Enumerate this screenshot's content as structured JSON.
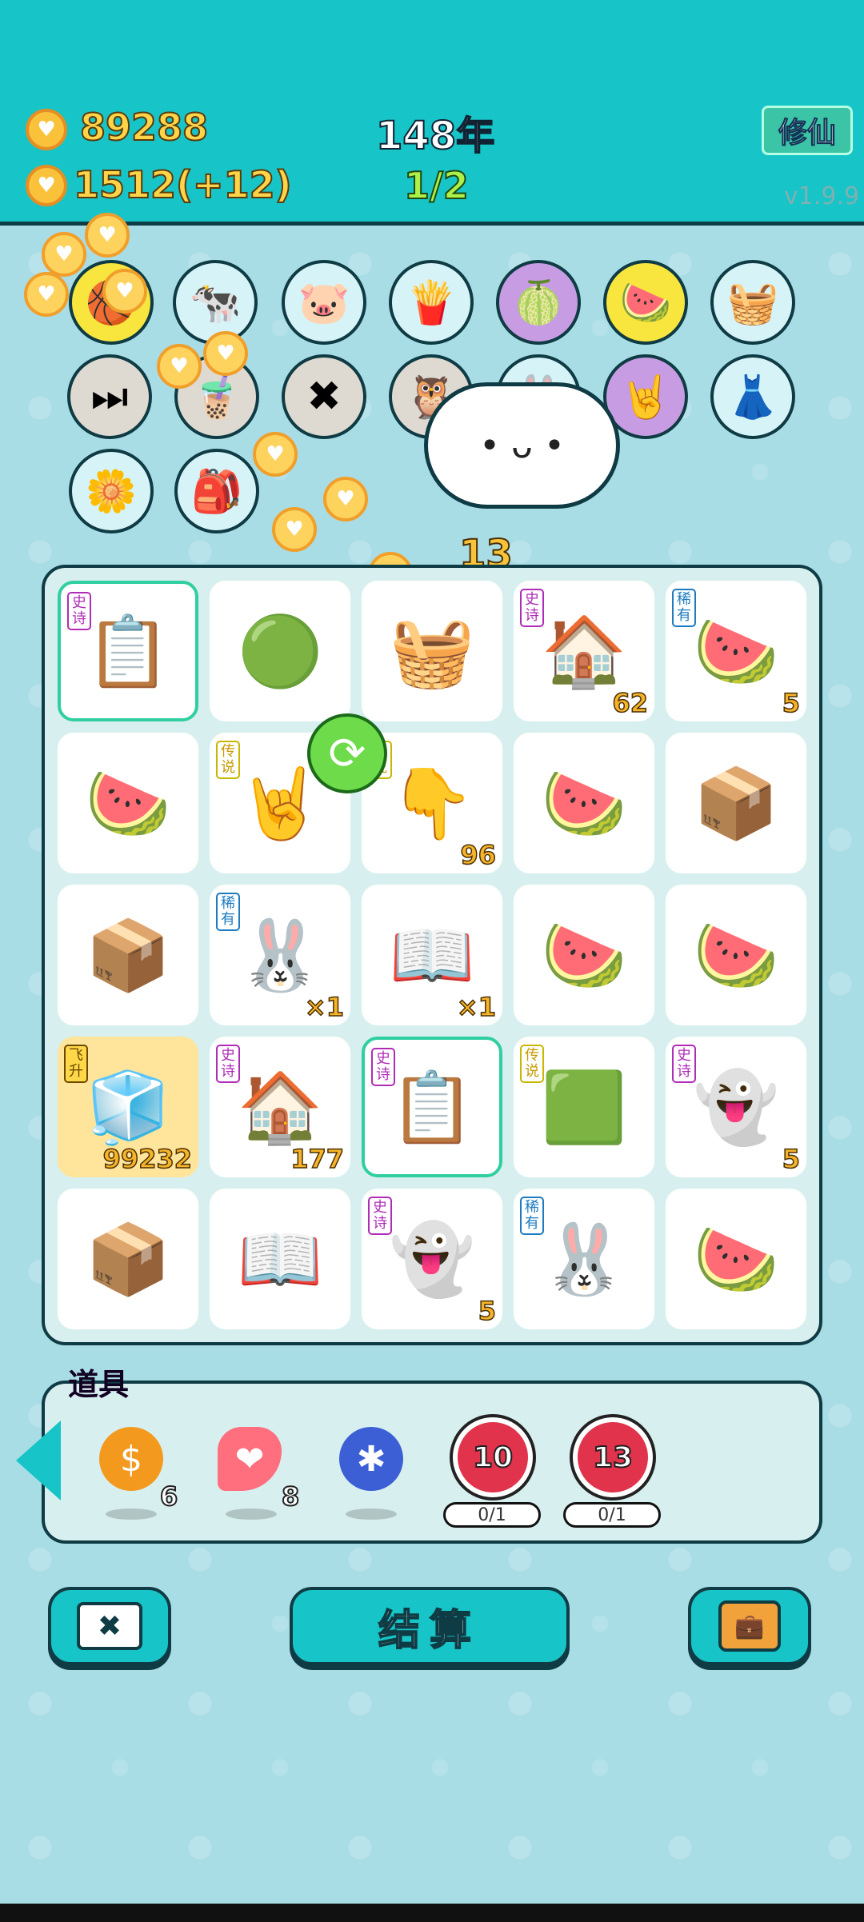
{
  "header": {
    "gold": "89288",
    "gems": "1512",
    "gems_delta": "(+12)",
    "year": "148年",
    "stage": "1/2",
    "mode_button": "修仙",
    "version": "v1.9.9"
  },
  "float_number": "13",
  "board": {
    "cells": [
      {
        "tag": "史诗",
        "tag_type": "epic",
        "icon": "copy-paste-icon",
        "count": "",
        "sel": true
      },
      {
        "tag": "",
        "tag_type": "",
        "icon": "green-potion-icon",
        "count": ""
      },
      {
        "tag": "",
        "tag_type": "",
        "icon": "basket-icon",
        "count": ""
      },
      {
        "tag": "史诗",
        "tag_type": "epic",
        "icon": "rabbit-house-icon",
        "count": "62"
      },
      {
        "tag": "稀有",
        "tag_type": "rare",
        "icon": "watermelon-slice-icon",
        "count": "5"
      },
      {
        "tag": "",
        "tag_type": "",
        "icon": "watermelon-slice-icon",
        "count": ""
      },
      {
        "tag": "传说",
        "tag_type": "legend",
        "icon": "rock-hand-icon",
        "count": ""
      },
      {
        "tag": "传说",
        "tag_type": "legend",
        "icon": "pointing-hand-icon",
        "count": "96"
      },
      {
        "tag": "",
        "tag_type": "",
        "icon": "watermelon-slice-icon",
        "count": ""
      },
      {
        "tag": "",
        "tag_type": "",
        "icon": "package-box-icon",
        "count": ""
      },
      {
        "tag": "",
        "tag_type": "",
        "icon": "package-box-icon",
        "count": ""
      },
      {
        "tag": "稀有",
        "tag_type": "rare",
        "icon": "rabbit-icon",
        "count": "×1"
      },
      {
        "tag": "",
        "tag_type": "",
        "icon": "book-icon",
        "count": "×1"
      },
      {
        "tag": "",
        "tag_type": "",
        "icon": "watermelon-slice-icon",
        "count": ""
      },
      {
        "tag": "",
        "tag_type": "",
        "icon": "watermelon-slice-icon",
        "count": ""
      },
      {
        "tag": "飞升",
        "tag_type": "ascend",
        "icon": "fridge-icon",
        "count": "99232",
        "gold": true
      },
      {
        "tag": "史诗",
        "tag_type": "epic",
        "icon": "rabbit-house-icon",
        "count": "177"
      },
      {
        "tag": "史诗",
        "tag_type": "epic",
        "icon": "copy-paste-icon",
        "count": "",
        "sel": true
      },
      {
        "tag": "传说",
        "tag_type": "legend",
        "icon": "whole-watermelon-icon",
        "count": ""
      },
      {
        "tag": "史诗",
        "tag_type": "epic",
        "icon": "ghost-icon",
        "count": "5"
      },
      {
        "tag": "",
        "tag_type": "",
        "icon": "package-box-icon",
        "count": ""
      },
      {
        "tag": "",
        "tag_type": "",
        "icon": "book-icon",
        "count": ""
      },
      {
        "tag": "史诗",
        "tag_type": "epic",
        "icon": "ghost-icon",
        "count": "5"
      },
      {
        "tag": "稀有",
        "tag_type": "rare",
        "icon": "rabbit-icon",
        "count": ""
      },
      {
        "tag": "",
        "tag_type": "",
        "icon": "watermelon-slice-icon",
        "count": ""
      }
    ]
  },
  "tools": {
    "title": "道具",
    "items": [
      {
        "icon": "dollar-coin-icon",
        "count": "6"
      },
      {
        "icon": "liver-icon",
        "count": "8"
      },
      {
        "icon": "blueberry-icon",
        "count": ""
      },
      {
        "icon": "target-10-icon",
        "value": "10",
        "progress": "0/1"
      },
      {
        "icon": "target-13-icon",
        "value": "13",
        "progress": "0/1"
      }
    ]
  },
  "buttons": {
    "settle": "结算"
  }
}
